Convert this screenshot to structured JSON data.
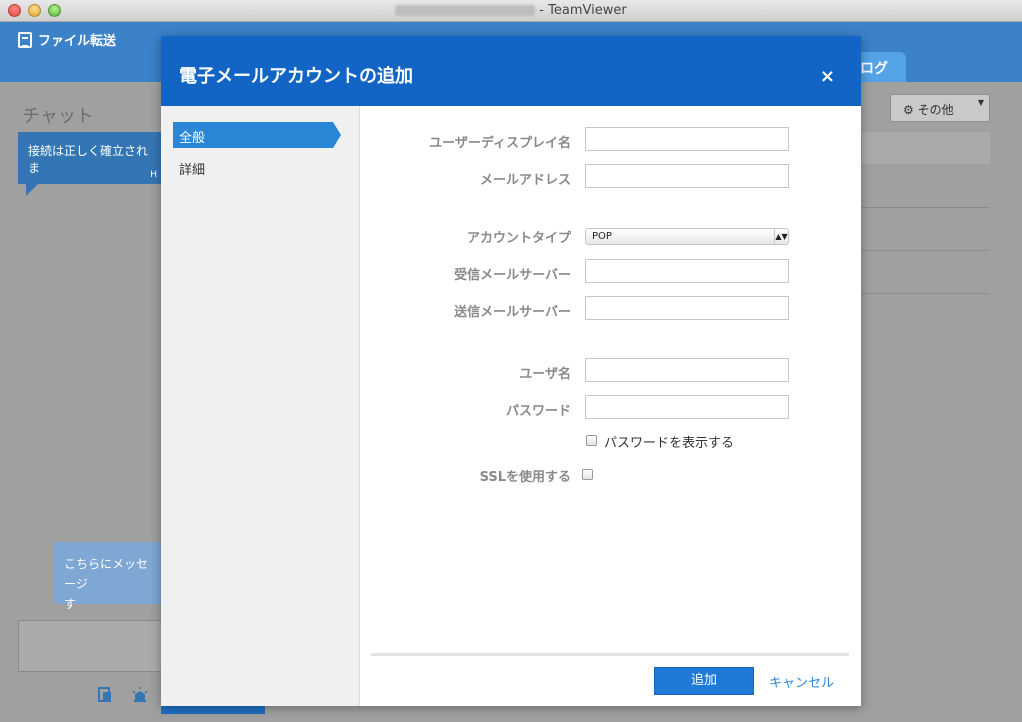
{
  "window": {
    "title_suffix": "- TeamViewer"
  },
  "app": {
    "file_transfer_label": "ファイル転送",
    "log_tab_label": "ログ",
    "chat_title": "チャット",
    "chat_message": "接続は正しく確立されま",
    "chat_message_tail": "H",
    "message_placeholder_line1": "こちらにメッセージ",
    "message_placeholder_line2": "す",
    "more_button_label": "その他"
  },
  "modal": {
    "title": "電子メールアカウントの追加",
    "close_label": "×",
    "nav": [
      {
        "label": "全般",
        "active": true
      },
      {
        "label": "詳細",
        "active": false
      }
    ],
    "fields": {
      "display_name": {
        "label": "ユーザーディスプレイ名",
        "value": ""
      },
      "email": {
        "label": "メールアドレス",
        "value": ""
      },
      "account_type": {
        "label": "アカウントタイプ",
        "value": "POP"
      },
      "incoming_server": {
        "label": "受信メールサーバー",
        "value": ""
      },
      "outgoing_server": {
        "label": "送信メールサーバー",
        "value": ""
      },
      "username": {
        "label": "ユーザ名",
        "value": ""
      },
      "password": {
        "label": "パスワード",
        "value": ""
      },
      "show_password": {
        "label": "パスワードを表示する",
        "checked": false
      },
      "use_ssl": {
        "label": "SSLを使用する",
        "checked": false
      }
    },
    "buttons": {
      "add": "追加",
      "cancel": "キャンセル"
    }
  },
  "colors": {
    "header_blue": "#1365c5",
    "accent_blue": "#2a87d8",
    "label_gray": "#8a8a8a"
  }
}
